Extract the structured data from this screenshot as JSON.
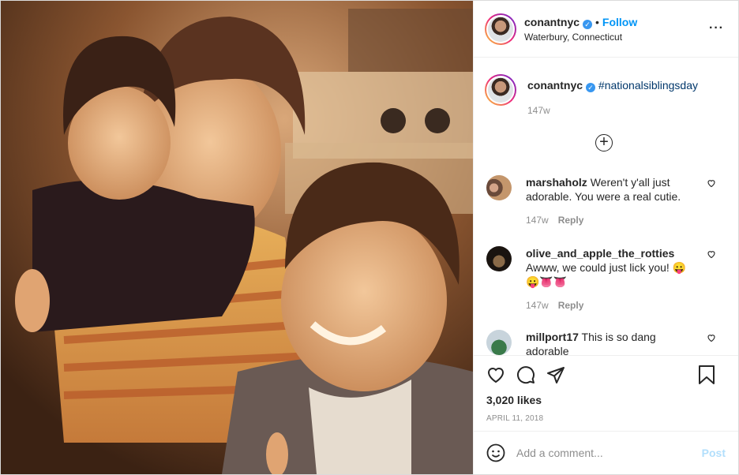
{
  "header": {
    "username": "conantnyc",
    "follow_label": "Follow",
    "location": "Waterbury, Connecticut",
    "more_icon": "more-icon"
  },
  "caption": {
    "username": "conantnyc",
    "text": "#nationalsiblingsday",
    "age": "147w"
  },
  "comments": [
    {
      "username": "marshaholz",
      "text": "Weren't y'all just adorable. You were a real cutie.",
      "age": "147w",
      "reply": "Reply"
    },
    {
      "username": "olive_and_apple_the_rotties",
      "text": "Awww, we could just lick you! 😛",
      "emojis": "😛👅👅",
      "age": "147w",
      "reply": "Reply"
    },
    {
      "username": "millport17",
      "text": "This is so dang adorable"
    }
  ],
  "actions": {
    "likes": "3,020 likes",
    "date": "APRIL 11, 2018"
  },
  "add_comment": {
    "placeholder": "Add a comment...",
    "post_label": "Post"
  },
  "colors": {
    "link": "#0095f6",
    "hashtag": "#00376b",
    "muted": "#8e8e8e",
    "post_disabled": "#b2dffc"
  }
}
